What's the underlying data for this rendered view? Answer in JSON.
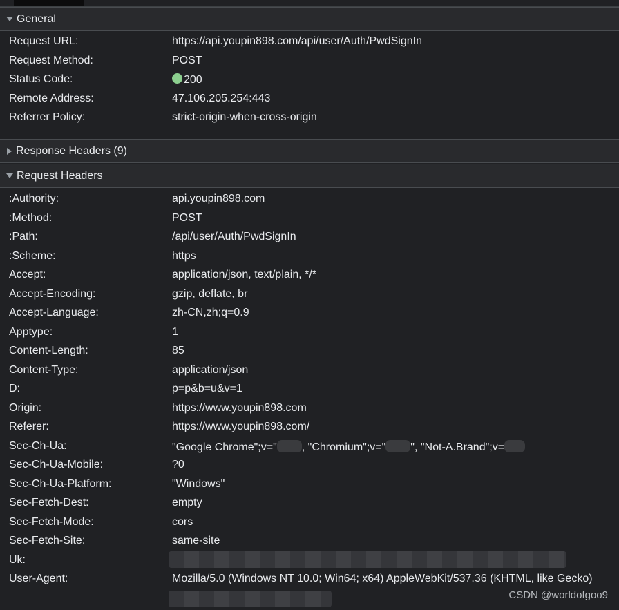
{
  "general": {
    "title": "General",
    "rows": [
      {
        "key": "Request URL:",
        "value": "https://api.youpin898.com/api/user/Auth/PwdSignIn"
      },
      {
        "key": "Request Method:",
        "value": "POST"
      },
      {
        "key": "Status Code:",
        "value": "200"
      },
      {
        "key": "Remote Address:",
        "value": "47.106.205.254:443"
      },
      {
        "key": "Referrer Policy:",
        "value": "strict-origin-when-cross-origin"
      }
    ]
  },
  "response_headers": {
    "title": "Response Headers (9)"
  },
  "request_headers": {
    "title": "Request Headers",
    "rows": [
      {
        "key": ":Authority:",
        "value": "api.youpin898.com"
      },
      {
        "key": ":Method:",
        "value": "POST"
      },
      {
        "key": ":Path:",
        "value": "/api/user/Auth/PwdSignIn"
      },
      {
        "key": ":Scheme:",
        "value": "https"
      },
      {
        "key": "Accept:",
        "value": "application/json, text/plain, */*"
      },
      {
        "key": "Accept-Encoding:",
        "value": "gzip, deflate, br"
      },
      {
        "key": "Accept-Language:",
        "value": "zh-CN,zh;q=0.9"
      },
      {
        "key": "Apptype:",
        "value": "1"
      },
      {
        "key": "Content-Length:",
        "value": "85"
      },
      {
        "key": "Content-Type:",
        "value": "application/json"
      },
      {
        "key": "D:",
        "value": "p=p&b=u&v=1"
      },
      {
        "key": "Origin:",
        "value": "https://www.youpin898.com"
      },
      {
        "key": "Referer:",
        "value": "https://www.youpin898.com/"
      },
      {
        "key": "Sec-Ch-Ua:",
        "value_parts": [
          "\"Google Chrome\";v=\"",
          ", \"Chromium\";v=\"",
          "\", \"Not-A.Brand\";v="
        ]
      },
      {
        "key": "Sec-Ch-Ua-Mobile:",
        "value": "?0"
      },
      {
        "key": "Sec-Ch-Ua-Platform:",
        "value": "\"Windows\""
      },
      {
        "key": "Sec-Fetch-Dest:",
        "value": "empty"
      },
      {
        "key": "Sec-Fetch-Mode:",
        "value": "cors"
      },
      {
        "key": "Sec-Fetch-Site:",
        "value": "same-site"
      },
      {
        "key": "Uk:",
        "value": ""
      },
      {
        "key": "User-Agent:",
        "value": "Mozilla/5.0 (Windows NT 10.0; Win64; x64) AppleWebKit/537.36 (KHTML, like Gecko)"
      }
    ]
  },
  "watermark": "CSDN @worldofgoo9",
  "colors": {
    "status_ok": "#8ccf8f",
    "background": "#202124",
    "section_bg": "#292a2d"
  }
}
